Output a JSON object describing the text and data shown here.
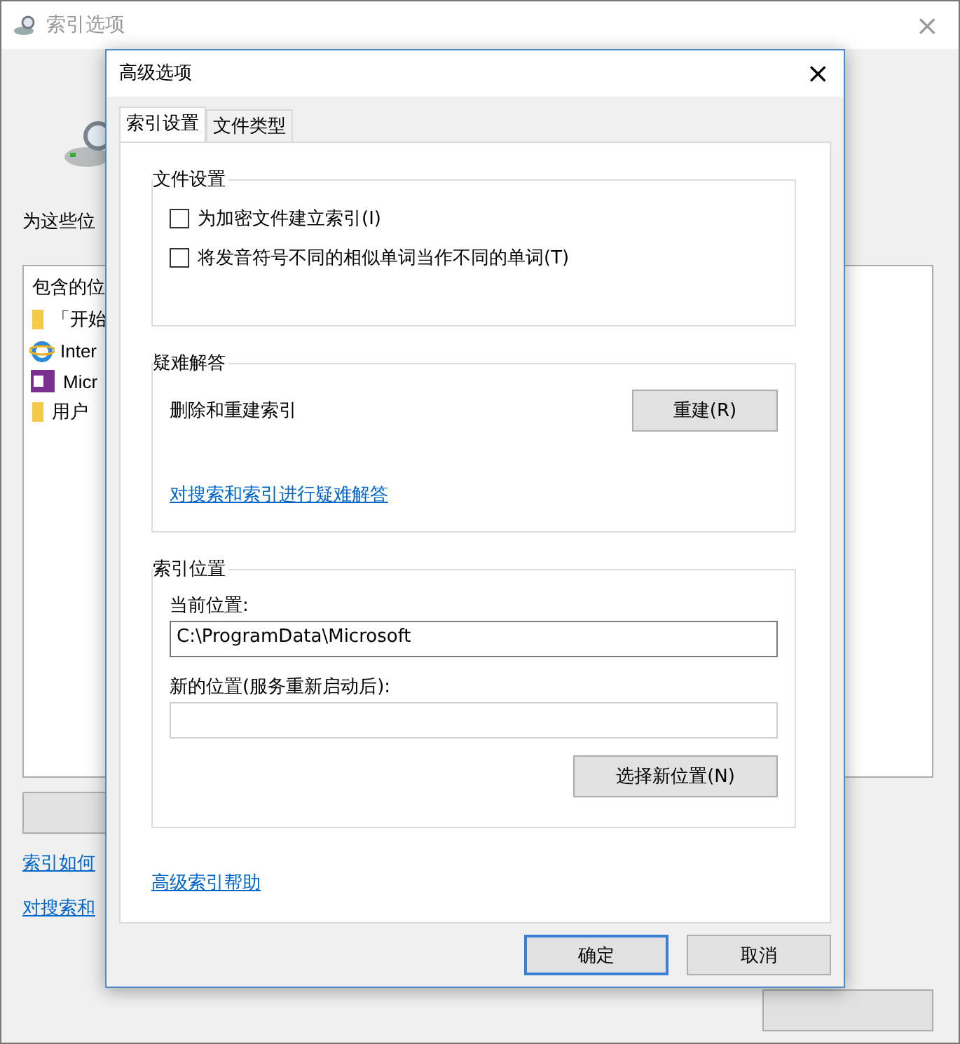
{
  "main_window": {
    "title": "索引选项",
    "close": "×",
    "prompt": "为这些位",
    "locations": {
      "header": "包含的位",
      "items": [
        {
          "kind": "folder",
          "label": "「开始"
        },
        {
          "kind": "browser",
          "label": "Inter"
        },
        {
          "kind": "notebook",
          "label": "Micr"
        },
        {
          "kind": "folder",
          "label": "用户"
        }
      ]
    },
    "links": [
      "索引如何",
      "对搜索和"
    ]
  },
  "dialog": {
    "title": "高级选项",
    "close": "×",
    "tabs": [
      {
        "label": "索引设置",
        "selected": true
      },
      {
        "label": "文件类型",
        "selected": false
      }
    ],
    "file_settings": {
      "title": "文件设置",
      "options": [
        {
          "label": "为加密文件建立索引(I)",
          "checked": false
        },
        {
          "label": "将发音符号不同的相似单词当作不同的单词(T)",
          "checked": false
        }
      ]
    },
    "troubleshooting": {
      "title": "疑难解答",
      "label": "删除和重建索引",
      "button": "重建(R)",
      "link": "对搜索和索引进行疑难解答"
    },
    "index_location": {
      "title": "索引位置",
      "current_label": "当前位置:",
      "current_value": "C:\\ProgramData\\Microsoft",
      "new_label": "新的位置(服务重新启动后):",
      "button": "选择新位置(N)"
    },
    "help_link": "高级索引帮助",
    "buttons": [
      {
        "label": "确定",
        "selected": true
      },
      {
        "label": "取消",
        "selected": false
      }
    ]
  }
}
